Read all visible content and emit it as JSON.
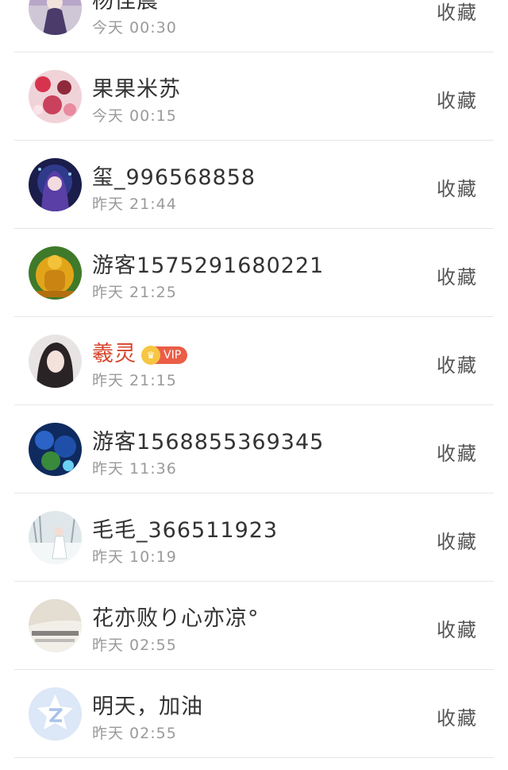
{
  "rows": [
    {
      "name": "杨佳晨",
      "time": "今天 00:30",
      "action": "收藏",
      "avatar": "purple-fantasy"
    },
    {
      "name": "果果米苏",
      "time": "今天 00:15",
      "action": "收藏",
      "avatar": "pink-floral"
    },
    {
      "name": "玺_996568858",
      "time": "昨天 21:44",
      "action": "收藏",
      "avatar": "anime-night"
    },
    {
      "name": "游客1575291680221",
      "time": "昨天 21:25",
      "action": "收藏",
      "avatar": "golden-buddha"
    },
    {
      "name": "羲灵",
      "time": "昨天 21:15",
      "action": "收藏",
      "avatar": "girl-portrait",
      "vip": true,
      "vip_label": "VIP"
    },
    {
      "name": "游客1568855369345",
      "time": "昨天 11:36",
      "action": "收藏",
      "avatar": "blue-flowers"
    },
    {
      "name": "毛毛_366511923",
      "time": "昨天 10:19",
      "action": "收藏",
      "avatar": "snow-girl"
    },
    {
      "name": "花亦败り心亦凉°",
      "time": "昨天 02:55",
      "action": "收藏",
      "avatar": "text-card"
    },
    {
      "name": "明天，加油",
      "time": "昨天 02:55",
      "action": "收藏",
      "avatar": "default-z"
    }
  ]
}
